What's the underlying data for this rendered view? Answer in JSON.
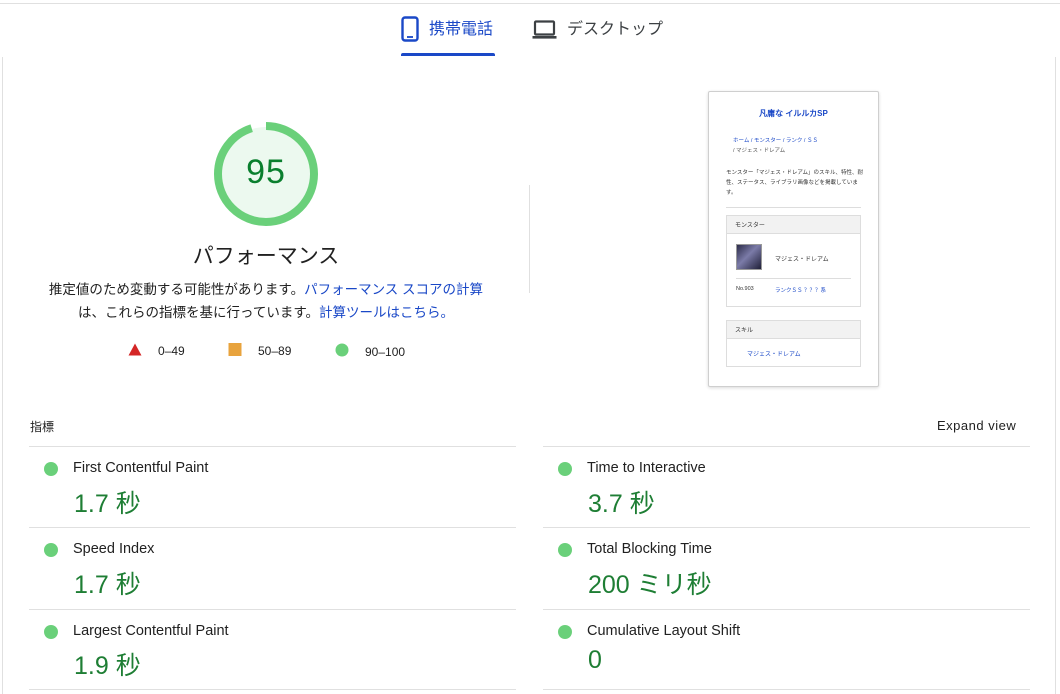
{
  "tabs": [
    {
      "label": "携帯電話",
      "icon": "smartphone-icon",
      "active": true
    },
    {
      "label": "デスクトップ",
      "icon": "laptop-icon",
      "active": false
    }
  ],
  "score": {
    "value": 95,
    "title": "パフォーマンス",
    "description_prefix": "推定値のため変動する可能性があります。",
    "link1": "パフォーマンス スコアの計算",
    "description_middle": "は、これらの指標を基に行っています。",
    "link2": "計算ツールはこちら。",
    "color": "#0cce6b"
  },
  "legend": [
    {
      "range": "0–49",
      "shape": "triangle",
      "color": "#ff4e42"
    },
    {
      "range": "50–89",
      "shape": "square",
      "color": "#ffa400"
    },
    {
      "range": "90–100",
      "shape": "circle",
      "color": "#0cce6b"
    }
  ],
  "thumbnail": {
    "site_title": "凡庸な イルルカSP",
    "crumb_line1": "ホーム / モンスター / ランク / ＳＳ",
    "crumb_line2": "/ マジェス・ドレアム",
    "intro": "モンスター「マジェス・ドレアム」のスキル、特性、耐性、ステータス、ライブラリ画像などを掲載しています。",
    "box1_head": "モンスター",
    "monster_name": "マジェス・ドレアム",
    "monster_no": "No.903",
    "monster_rank": "ランクＳＳ ？？？系",
    "box2_head": "スキル",
    "skill_name": "マジェス・ドレアム"
  },
  "metrics_header": {
    "title": "指標",
    "expand": "Expand view"
  },
  "metrics": [
    {
      "label": "First Contentful Paint",
      "value": "1.7 秒"
    },
    {
      "label": "Time to Interactive",
      "value": "3.7 秒"
    },
    {
      "label": "Speed Index",
      "value": "1.7 秒"
    },
    {
      "label": "Total Blocking Time",
      "value": "200 ミリ秒"
    },
    {
      "label": "Largest Contentful Paint",
      "value": "1.9 秒"
    },
    {
      "label": "Cumulative Layout Shift",
      "value": "0"
    }
  ]
}
